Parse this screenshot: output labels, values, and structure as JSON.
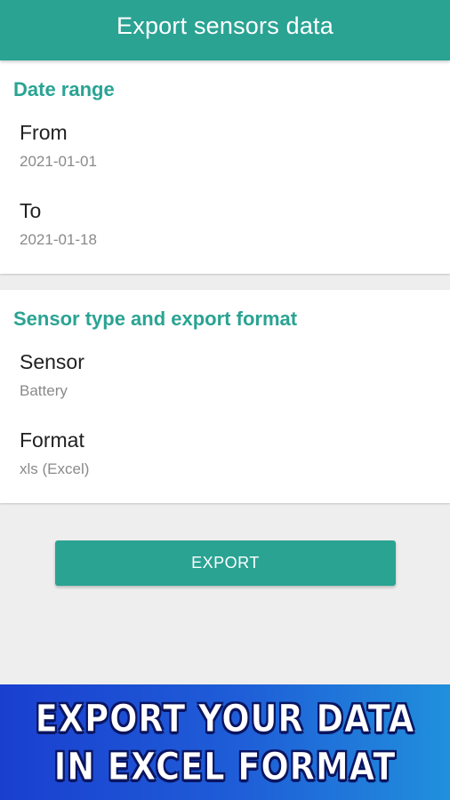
{
  "app_bar": {
    "title": "Export sensors data",
    "color": "#2aa393"
  },
  "date_range": {
    "title": "Date range",
    "from": {
      "label": "From",
      "value": "2021-01-01"
    },
    "to": {
      "label": "To",
      "value": "2021-01-18"
    }
  },
  "sensor_section": {
    "title": "Sensor type and export format",
    "sensor": {
      "label": "Sensor",
      "value": "Battery"
    },
    "format": {
      "label": "Format",
      "value": "xls (Excel)"
    }
  },
  "export_button": {
    "label": "EXPORT"
  },
  "promo": {
    "line1": "EXPORT YOUR DATA",
    "line2": "IN EXCEL FORMAT"
  }
}
